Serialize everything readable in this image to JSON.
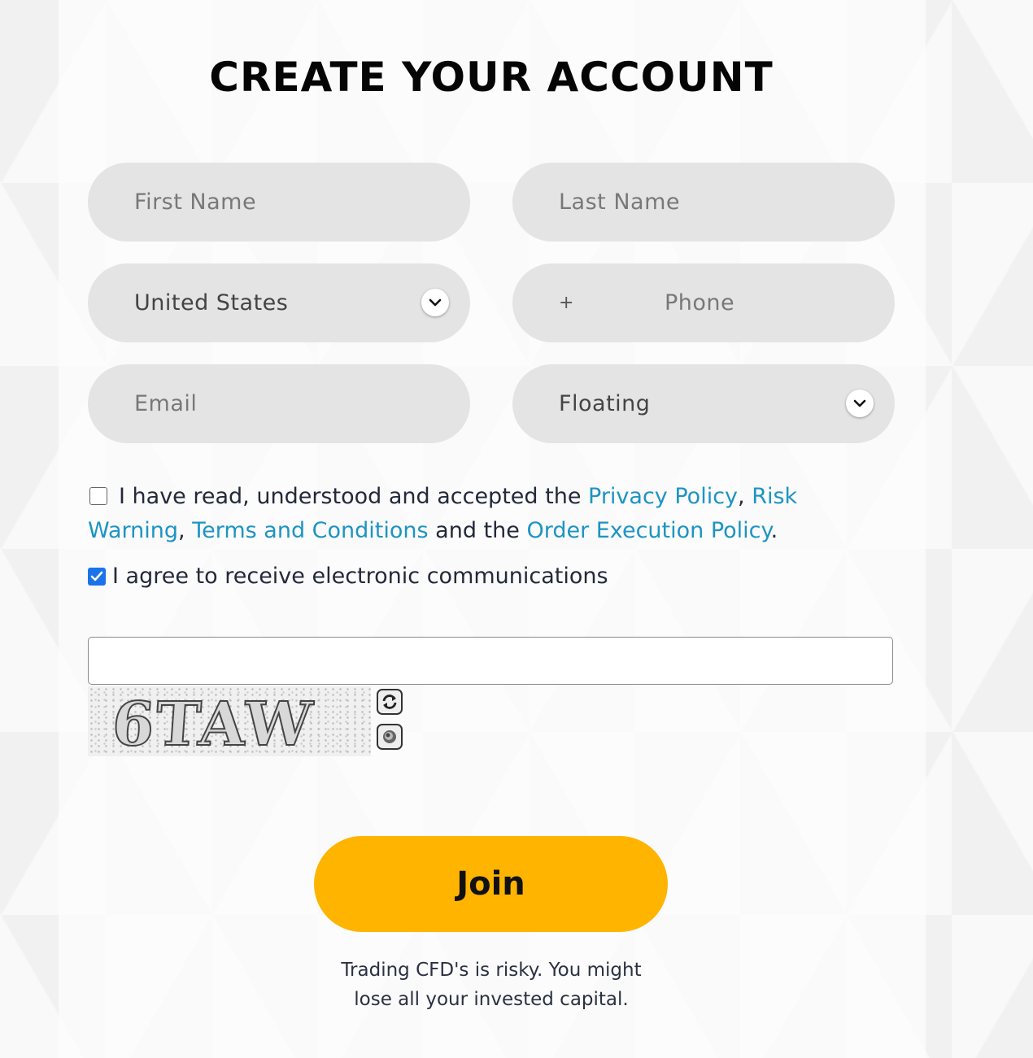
{
  "page": {
    "title": "CREATE YOUR ACCOUNT"
  },
  "form": {
    "first_name_placeholder": "First Name",
    "last_name_placeholder": "Last Name",
    "country_value": "United States",
    "phone_prefix": "+",
    "phone_placeholder": "Phone",
    "email_placeholder": "Email",
    "account_type_value": "Floating"
  },
  "consent": {
    "checked": false,
    "text_1": "I have read, understood and accepted the ",
    "privacy_link": "Privacy Policy",
    "sep_1": ", ",
    "risk_link": "Risk Warning",
    "sep_2": ", ",
    "terms_link": "Terms and Conditions",
    "text_2": " and the ",
    "order_link": "Order Execution Policy",
    "text_3": "."
  },
  "communications": {
    "checked": true,
    "label": "I agree to receive electronic communications"
  },
  "captcha": {
    "input_value": "",
    "image_text": "6TAW"
  },
  "actions": {
    "join_label": "Join"
  },
  "disclaimer": {
    "line_1": "Trading CFD's is risky. You might",
    "line_2": "lose all your invested capital."
  },
  "colors": {
    "accent": "#ffb400",
    "link": "#1d94c3",
    "field_bg": "#e4e4e4",
    "checkbox": "#1a73e8"
  }
}
